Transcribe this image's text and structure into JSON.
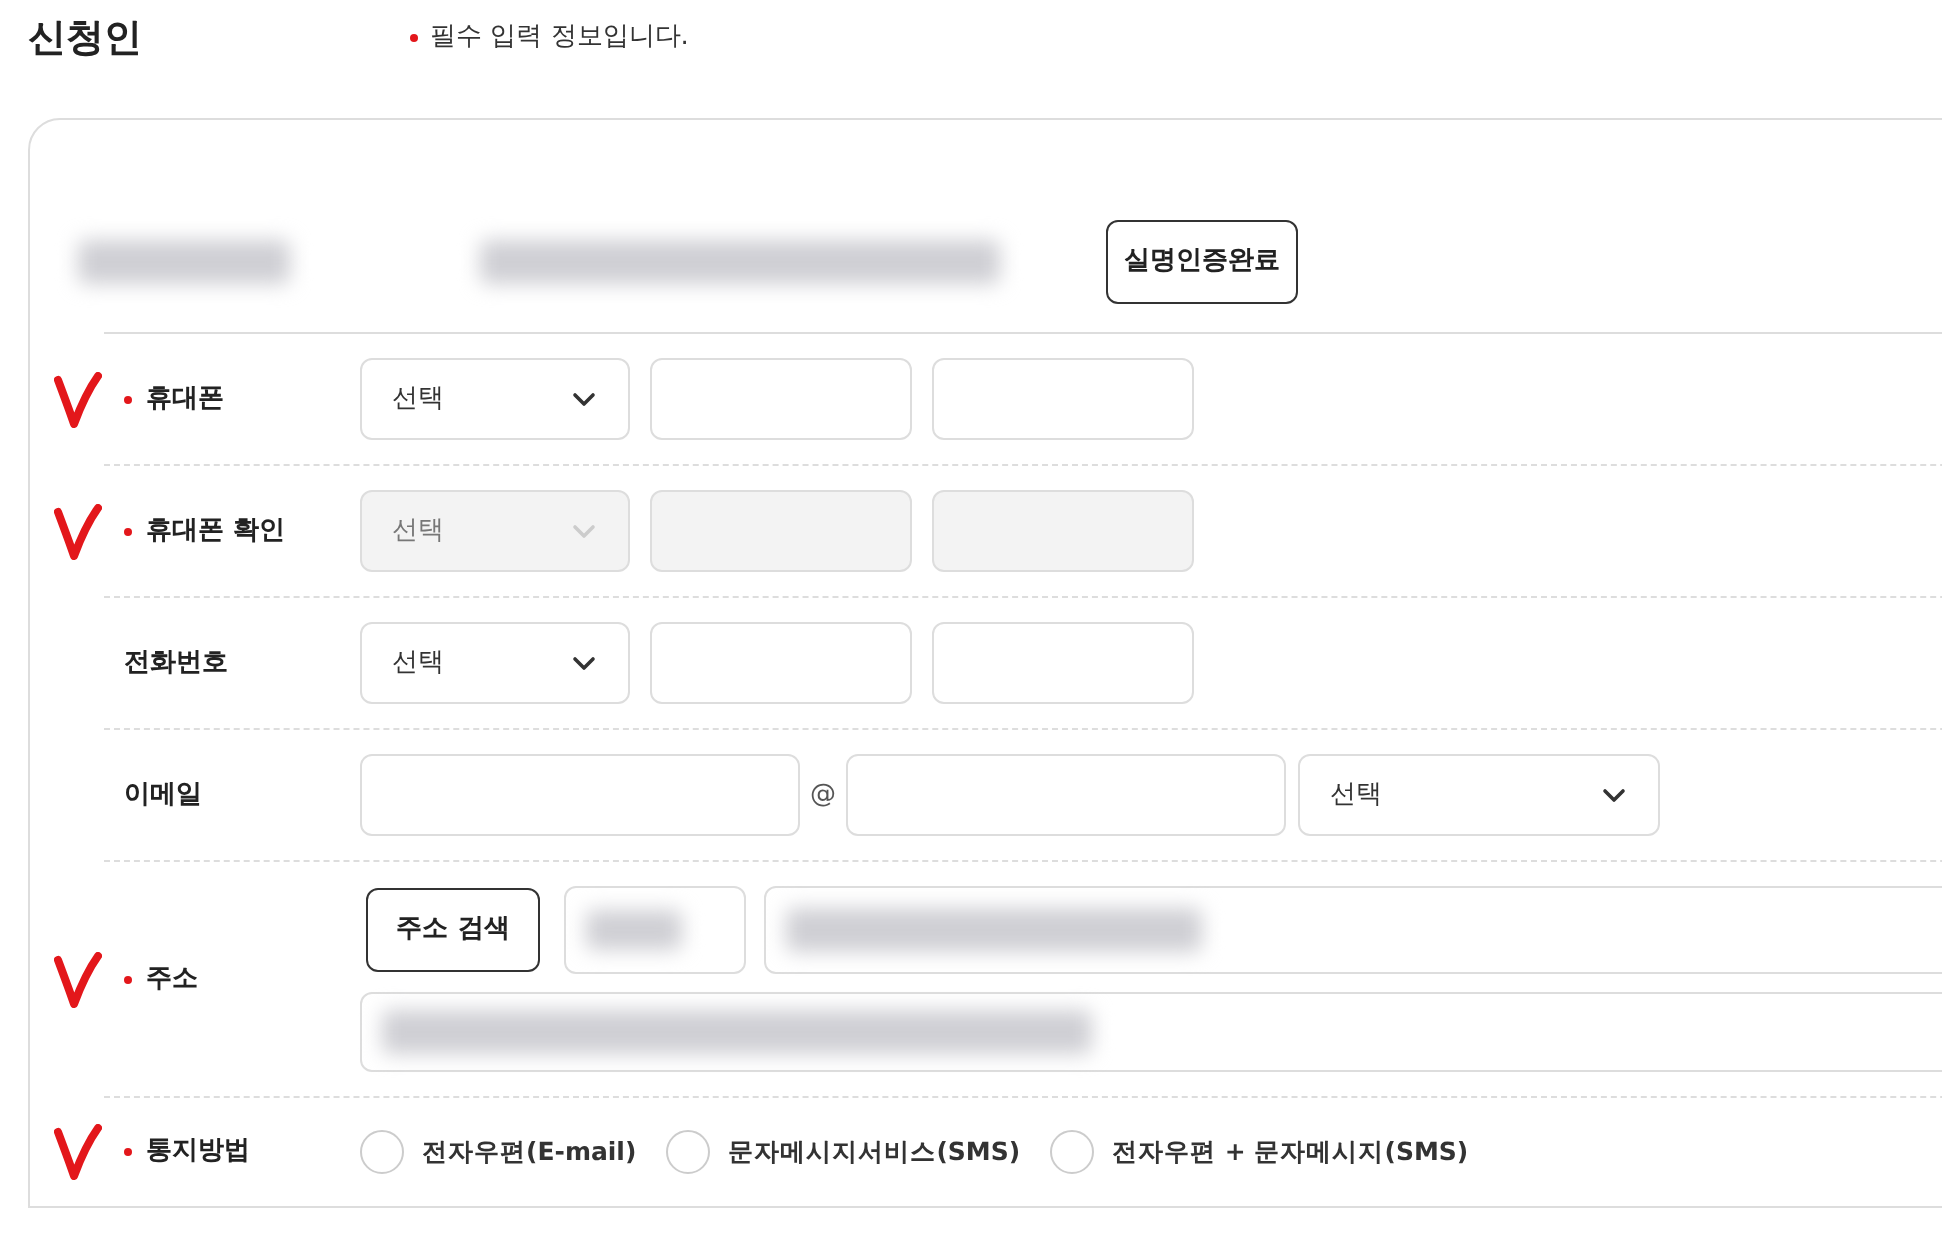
{
  "title": "신청인",
  "required_note": "필수 입력 정보입니다.",
  "verify_button": "실명인증완료",
  "rows": [
    {
      "kind": "phone",
      "label": "휴대폰",
      "required": true,
      "marked": true,
      "disabled": false,
      "select": "선택"
    },
    {
      "kind": "phone",
      "label": "휴대폰 확인",
      "required": true,
      "marked": true,
      "disabled": true,
      "select": "선택"
    },
    {
      "kind": "phone",
      "label": "전화번호",
      "required": false,
      "marked": false,
      "disabled": false,
      "select": "선택"
    },
    {
      "kind": "email",
      "label": "이메일",
      "required": false,
      "marked": false,
      "at": "@",
      "select": "선택"
    },
    {
      "kind": "address",
      "label": "주소",
      "required": true,
      "marked": true,
      "button": "주소 검색"
    },
    {
      "kind": "radio",
      "label": "통지방법",
      "required": true,
      "marked": true,
      "options": [
        {
          "label": "전자우편(E-mail)",
          "selected": false
        },
        {
          "label": "문자메시지서비스(SMS)",
          "selected": false
        },
        {
          "label": "전자우편 + 문자메시지(SMS)",
          "selected": false
        }
      ]
    }
  ]
}
